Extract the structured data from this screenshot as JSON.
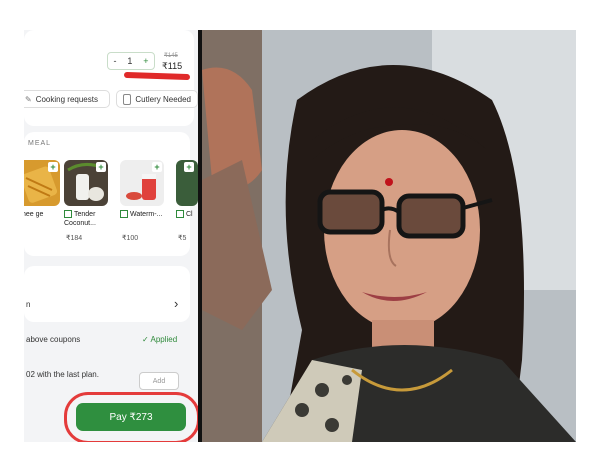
{
  "cart": {
    "quantity": {
      "minus": "-",
      "value": "1",
      "plus": "+"
    },
    "original_price": "₹145",
    "price": "₹115",
    "chips": {
      "cooking": "Cooking requests",
      "cutlery": "Cutlery Needed"
    },
    "section_label": "MEAL",
    "items": [
      {
        "name": "hee ge",
        "price": ""
      },
      {
        "name": "Tender Coconut...",
        "price": "₹184"
      },
      {
        "name": "Waterm-...",
        "price": "₹100"
      },
      {
        "name": "Cl",
        "price": "₹5"
      }
    ],
    "row1_label": "n",
    "row1_arrow": "›",
    "coupons_text": "above coupons",
    "applied_text": "✓ Applied",
    "plan_text": "02 with the last plan.",
    "add_label": "Add",
    "pay_label": "Pay ₹273"
  },
  "colors": {
    "accent_green": "#2f8f3f",
    "annotation_red": "#e02a2a"
  }
}
